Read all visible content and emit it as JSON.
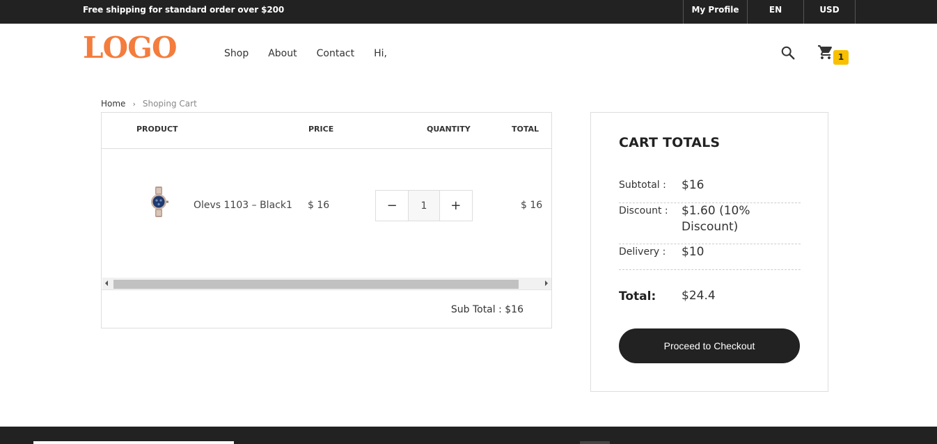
{
  "topbar": {
    "promo": "Free shipping for standard order over $200",
    "my_profile": "My Profile",
    "language": "EN",
    "currency": "USD"
  },
  "header": {
    "logo": "LOGO",
    "nav": [
      "Shop",
      "About",
      "Contact",
      "Hi,"
    ],
    "cart_count": "1"
  },
  "breadcrumb": {
    "home": "Home",
    "separator": "›",
    "current": "Shoping Cart"
  },
  "cart": {
    "columns": {
      "product": "PRODUCT",
      "price": "PRICE",
      "quantity": "QUANTITY",
      "total": "TOTAL"
    },
    "items": [
      {
        "name": "Olevs 1103 – Black1",
        "price": "$ 16",
        "quantity": "1",
        "total": "$ 16"
      }
    ],
    "qty_minus": "−",
    "qty_plus": "+",
    "subtotal_text": "Sub Total : $16"
  },
  "totals": {
    "title": "CART TOTALS",
    "subtotal_label": "Subtotal :",
    "subtotal_value": "$16",
    "discount_label": "Discount :",
    "discount_value": "$1.60 (10% Discount)",
    "delivery_label": "Delivery :",
    "delivery_value": "$10",
    "total_label": "Total:",
    "total_value": "$24.4",
    "checkout_label": "Proceed to Checkout"
  },
  "colors": {
    "brand": "#f47c3c",
    "dark": "#222222",
    "badge": "#f8c000"
  }
}
